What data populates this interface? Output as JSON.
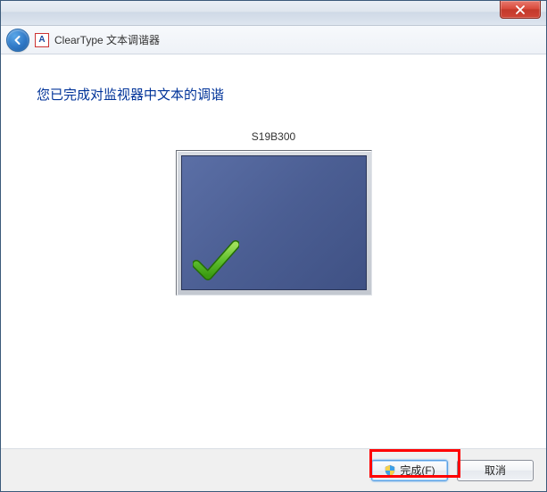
{
  "window": {
    "app_title": "ClearType 文本调谐器",
    "app_icon_letter": "A"
  },
  "main": {
    "headline": "您已完成对监视器中文本的调谐",
    "monitor_name": "S19B300"
  },
  "footer": {
    "finish_label": "完成(F)",
    "cancel_label": "取消"
  }
}
